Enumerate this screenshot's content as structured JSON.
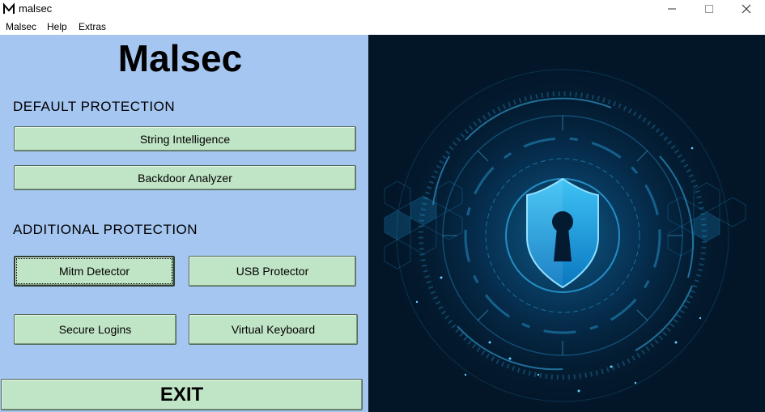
{
  "window": {
    "title": "malsec",
    "icon": "malsec-logo-icon"
  },
  "window_controls": {
    "minimize": "minimize-icon",
    "maximize": "maximize-icon",
    "close": "close-icon"
  },
  "menu": {
    "items": [
      "Malsec",
      "Help",
      "Extras"
    ]
  },
  "panel": {
    "app_name": "Malsec",
    "default_section": "DEFAULT PROTECTION",
    "additional_section": "ADDITIONAL PROTECTION",
    "buttons": {
      "string_intelligence": "String Intelligence",
      "backdoor_analyzer": "Backdoor Analyzer",
      "mitm_detector": "Mitm Detector",
      "usb_protector": "USB Protector",
      "secure_logins": "Secure Logins",
      "virtual_keyboard": "Virtual Keyboard",
      "exit": "EXIT"
    }
  },
  "colors": {
    "panel_bg": "#a5c6f1",
    "button_bg": "#c0e4c6",
    "art_bg": "#031628",
    "art_glow": "#1fa8e6"
  },
  "illustration": {
    "icon": "shield-keyhole-icon"
  }
}
